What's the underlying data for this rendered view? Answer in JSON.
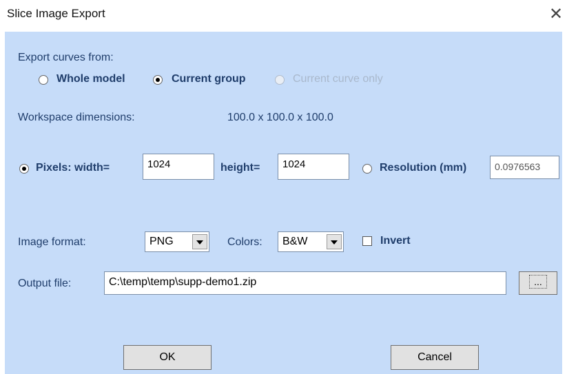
{
  "window": {
    "title": "Slice Image Export",
    "close_glyph": "✕"
  },
  "export": {
    "label": "Export curves from:",
    "options": [
      {
        "label": "Whole model",
        "checked": false,
        "enabled": true
      },
      {
        "label": "Current group",
        "checked": true,
        "enabled": true
      },
      {
        "label": "Current curve only",
        "checked": false,
        "enabled": false
      }
    ]
  },
  "workspace": {
    "label": "Workspace dimensions:",
    "value": "100.0 x 100.0 x 100.0"
  },
  "size": {
    "pixels_label": "Pixels: width=",
    "width_value": "1024",
    "height_label": "height=",
    "height_value": "1024",
    "resolution_label": "Resolution (mm)",
    "resolution_value": "0.0976563",
    "pixels_checked": true,
    "resolution_checked": false
  },
  "format": {
    "label": "Image format:",
    "value": "PNG",
    "colors_label": "Colors:",
    "colors_value": "B&W",
    "invert_label": "Invert",
    "invert_checked": false
  },
  "output": {
    "label": "Output file:",
    "value": "C:\\temp\\temp\\supp-demo1.zip",
    "browse_label": "..."
  },
  "buttons": {
    "ok": "OK",
    "cancel": "Cancel"
  },
  "colors": {
    "client_bg": "#c6dcf9",
    "label_text": "#1f3d6b"
  }
}
